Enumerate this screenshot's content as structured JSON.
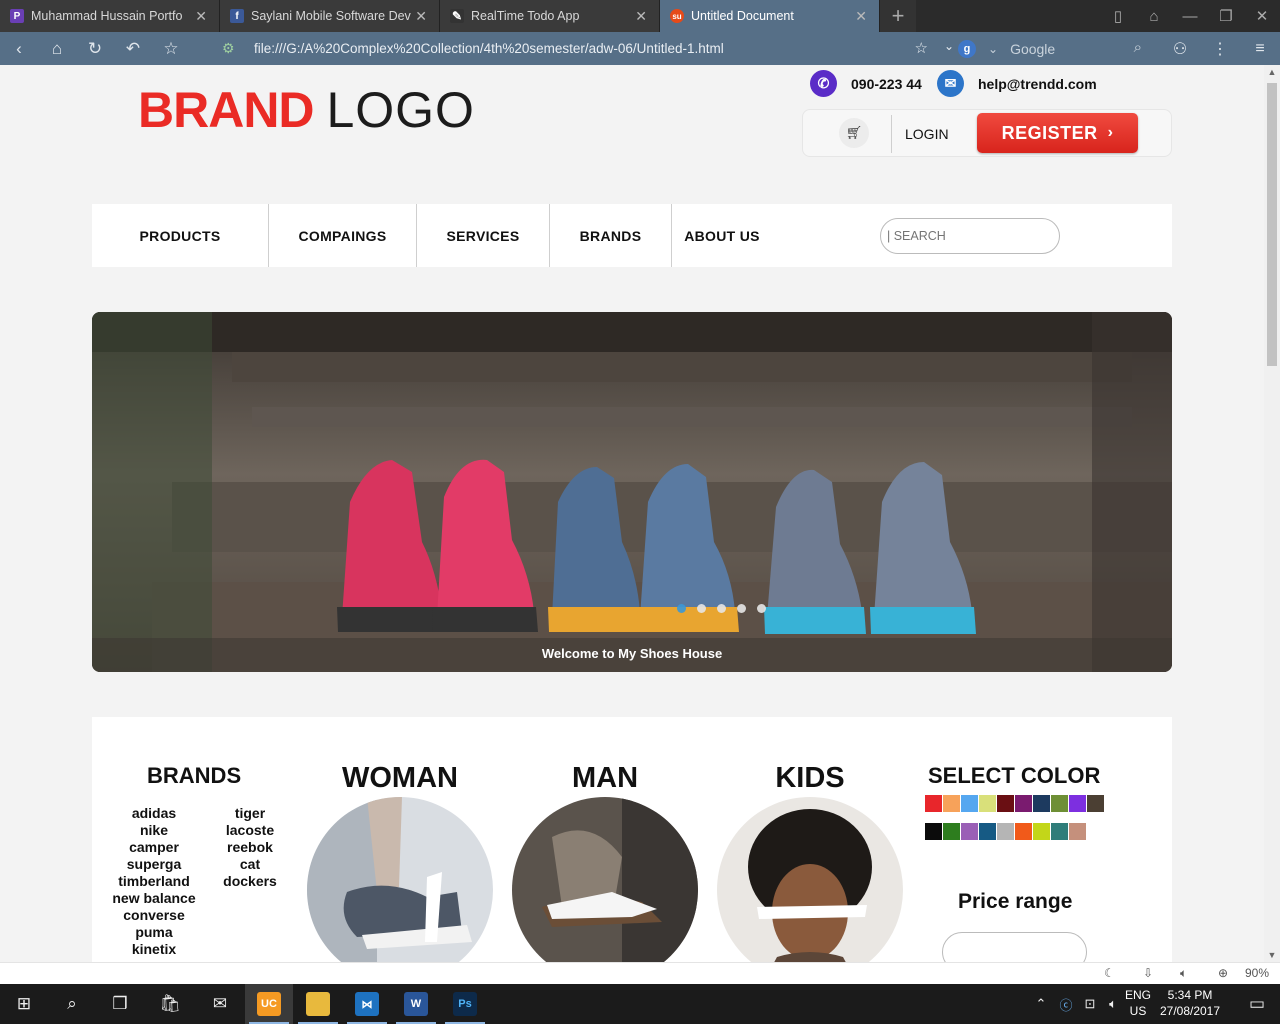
{
  "browser": {
    "tabs": [
      {
        "label": "Muhammad Hussain Portfo",
        "favicon": "P",
        "color": "#6a3fb5"
      },
      {
        "label": "Saylani Mobile Software Dev",
        "favicon": "f",
        "color": "#3b5998"
      },
      {
        "label": "RealTime Todo App",
        "favicon": "✎",
        "color": "#333333"
      },
      {
        "label": "Untitled Document",
        "favicon": "su",
        "color": "#e64a19"
      }
    ],
    "url": "file:///G:/A%20Complex%20Collection/4th%20semester/adw-06/Untitled-1.html",
    "search_engine": "g",
    "search_placeholder": "Google",
    "zoom": "90%"
  },
  "header": {
    "logo_brand": "BRAND",
    "logo_word": "LOGO",
    "phone": "090-223 44",
    "email": "help@trendd.com",
    "login": "LOGIN",
    "register": "REGISTER"
  },
  "nav": {
    "items": [
      "PRODUCTS",
      "COMPAINGS",
      "SERVICES",
      "BRANDS",
      "ABOUT US"
    ],
    "search_placeholder": "| SEARCH"
  },
  "hero": {
    "caption": "Welcome to My Shoes House",
    "slides": 5,
    "active_slide": 1
  },
  "catalog": {
    "brands_heading": "BRANDS",
    "brands_col1": [
      "adidas",
      "nike",
      "camper",
      "superga",
      "timberland",
      "new balance",
      "converse",
      "puma",
      "kinetix"
    ],
    "brands_col2": [
      "tiger",
      "lacoste",
      "reebok",
      "cat",
      "dockers"
    ],
    "categories": [
      "WOMAN",
      "MAN",
      "KIDS"
    ],
    "color_heading": "SELECT COLOR",
    "colors_row1": [
      "#e8262b",
      "#f7a25a",
      "#55a7f0",
      "#d9e07a",
      "#6a0f13",
      "#7a1b6f",
      "#1d3a5f",
      "#6e8f35",
      "#7d2fe0",
      "#4b3f33"
    ],
    "colors_row2": [
      "#0b0b0b",
      "#2d7d1e",
      "#9a5fb6",
      "#165a84",
      "#b5b5b5",
      "#f15a1a",
      "#c3d619",
      "#2f7d7a",
      "#c5907c"
    ],
    "price_heading": "Price range"
  },
  "taskbar": {
    "lang_top": "ENG",
    "lang_bottom": "US",
    "time": "5:34 PM",
    "date": "27/08/2017"
  }
}
